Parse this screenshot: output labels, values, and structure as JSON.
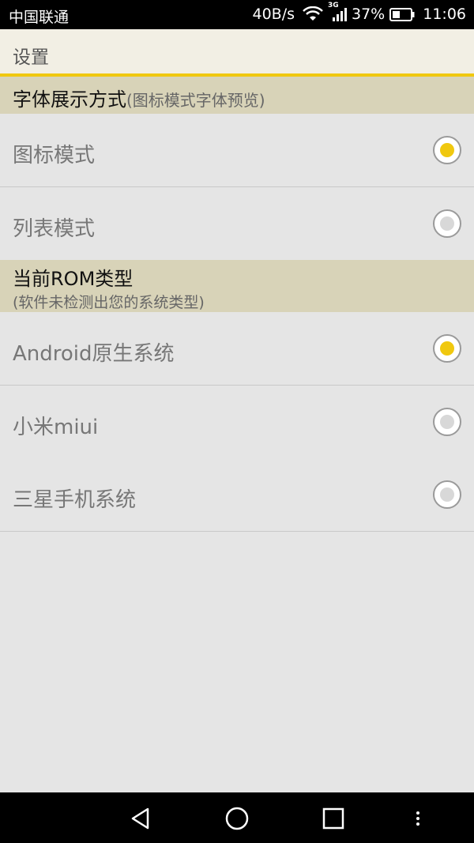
{
  "status_bar": {
    "carrier": "中国联通",
    "speed": "40B/s",
    "network_type": "3G",
    "battery": "37%",
    "time": "11:06"
  },
  "title_bar": {
    "title": "设置"
  },
  "section_font": {
    "title": "字体展示方式",
    "subtitle": "(图标模式字体预览)",
    "options": [
      {
        "label": "图标模式",
        "selected": true
      },
      {
        "label": "列表模式",
        "selected": false
      }
    ]
  },
  "section_rom": {
    "title": "当前ROM类型",
    "subtitle": "(软件未检测出您的系统类型)",
    "options": [
      {
        "label": "Android原生系统",
        "selected": true
      },
      {
        "label": "小米miui",
        "selected": false
      },
      {
        "label": "三星手机系统",
        "selected": false
      }
    ]
  },
  "colors": {
    "accent": "#f0c80f",
    "section_bg": "#d8d3b8",
    "title_bg": "#f2efe4"
  }
}
